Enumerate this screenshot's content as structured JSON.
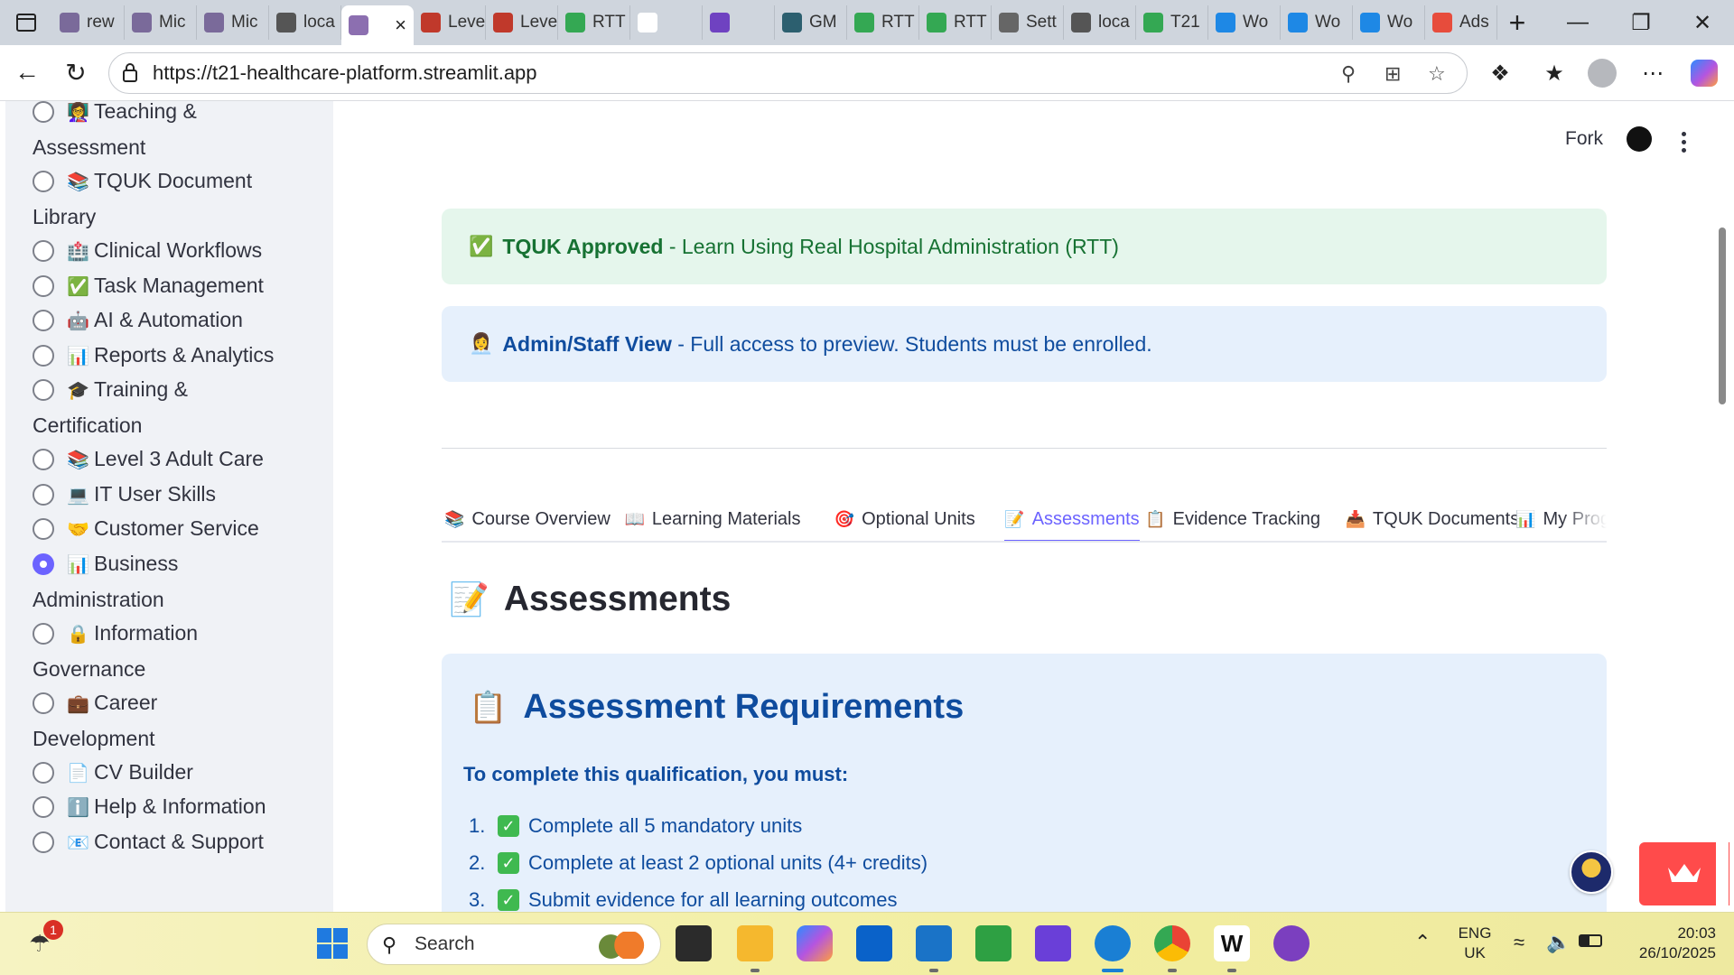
{
  "browser": {
    "tabs": [
      {
        "label": "rew",
        "fav_color": "#7a6a9a"
      },
      {
        "label": "Mic",
        "fav_color": "#7a6a9a"
      },
      {
        "label": "Mic",
        "fav_color": "#7a6a9a"
      },
      {
        "label": "loca",
        "fav_color": "#555555"
      },
      {
        "label": "",
        "fav_color": "#8c6fb0",
        "active": true
      },
      {
        "label": "Leve",
        "fav_color": "#c0392b"
      },
      {
        "label": "Leve",
        "fav_color": "#c0392b"
      },
      {
        "label": "RTT",
        "fav_color": "#34a853"
      },
      {
        "label": "",
        "fav_color": "#ffffff"
      },
      {
        "label": "",
        "fav_color": "#6f42c1"
      },
      {
        "label": "GM",
        "fav_color": "#2c5f6f"
      },
      {
        "label": "RTT",
        "fav_color": "#34a853"
      },
      {
        "label": "RTT",
        "fav_color": "#34a853"
      },
      {
        "label": "Sett",
        "fav_color": "#666666"
      },
      {
        "label": "loca",
        "fav_color": "#555555"
      },
      {
        "label": "T21",
        "fav_color": "#34a853"
      },
      {
        "label": "Wo",
        "fav_color": "#1e88e5"
      },
      {
        "label": "Wo",
        "fav_color": "#1e88e5"
      },
      {
        "label": "Wo",
        "fav_color": "#1e88e5"
      },
      {
        "label": "Ads",
        "fav_color": "#e74c3c"
      }
    ],
    "new_tab": "+",
    "url": "https://t21-healthcare-platform.streamlit.app"
  },
  "sidebar": {
    "items": [
      {
        "emoji": "👩‍🏫",
        "label": "Teaching & Assessment",
        "lines": [
          "Teaching &",
          "Assessment"
        ]
      },
      {
        "emoji": "📚",
        "label": "TQUK Document Library",
        "lines": [
          "TQUK Document",
          "Library"
        ]
      },
      {
        "emoji": "🏥",
        "label": "Clinical Workflows",
        "lines": [
          "Clinical Workflows"
        ]
      },
      {
        "emoji": "✅",
        "label": "Task Management",
        "lines": [
          "Task Management"
        ]
      },
      {
        "emoji": "🤖",
        "label": "AI & Automation",
        "lines": [
          "AI & Automation"
        ]
      },
      {
        "emoji": "📊",
        "label": "Reports & Analytics",
        "lines": [
          "Reports & Analytics"
        ]
      },
      {
        "emoji": "🎓",
        "label": "Training & Certification",
        "lines": [
          "Training &",
          "Certification"
        ]
      },
      {
        "emoji": "📚",
        "label": "Level 3 Adult Care",
        "lines": [
          "Level 3 Adult Care"
        ]
      },
      {
        "emoji": "💻",
        "label": "IT User Skills",
        "lines": [
          "IT User Skills"
        ]
      },
      {
        "emoji": "🤝",
        "label": "Customer Service",
        "lines": [
          "Customer Service"
        ]
      },
      {
        "emoji": "📊",
        "label": "Business Administration",
        "lines": [
          "Business",
          "Administration"
        ],
        "selected": true
      },
      {
        "emoji": "🔒",
        "label": "Information Governance",
        "lines": [
          "Information",
          "Governance"
        ]
      },
      {
        "emoji": "💼",
        "label": "Career Development",
        "lines": [
          "Career",
          "Development"
        ]
      },
      {
        "emoji": "📄",
        "label": "CV Builder",
        "lines": [
          "CV Builder"
        ]
      },
      {
        "emoji": "ℹ️",
        "label": "Help & Information",
        "lines": [
          "Help & Information"
        ]
      },
      {
        "emoji": "📧",
        "label": "Contact & Support",
        "lines": [
          "Contact & Support"
        ]
      }
    ]
  },
  "toolbar": {
    "fork_label": "Fork"
  },
  "alerts": {
    "success": {
      "emoji": "✅",
      "bold": "TQUK Approved",
      "text": " - Learn Using Real Hospital Administration (RTT)"
    },
    "info": {
      "emoji": "👩‍💼",
      "bold": "Admin/Staff View",
      "text": " - Full access to preview. Students must be enrolled."
    }
  },
  "tabs": [
    {
      "emoji": "📚",
      "label": "Course Overview"
    },
    {
      "emoji": "📖",
      "label": "Learning Materials"
    },
    {
      "emoji": "🎯",
      "label": "Optional Units"
    },
    {
      "emoji": "📝",
      "label": "Assessments",
      "active": true
    },
    {
      "emoji": "📋",
      "label": "Evidence Tracking"
    },
    {
      "emoji": "📥",
      "label": "TQUK Documents"
    },
    {
      "emoji": "📊",
      "label": "My Progress"
    }
  ],
  "section": {
    "emoji": "📝",
    "title": "Assessments"
  },
  "requirements": {
    "emoji": "📋",
    "title": "Assessment Requirements",
    "subtitle": "To complete this qualification, you must:",
    "items": [
      "Complete all 5 mandatory units",
      "Complete at least 2 optional units (4+ credits)",
      "Submit evidence for all learning outcomes"
    ]
  },
  "taskbar": {
    "search_placeholder": "Search",
    "notification_count": "1",
    "lang_line1": "ENG",
    "lang_line2": "UK",
    "time": "20:03",
    "date": "26/10/2025"
  }
}
